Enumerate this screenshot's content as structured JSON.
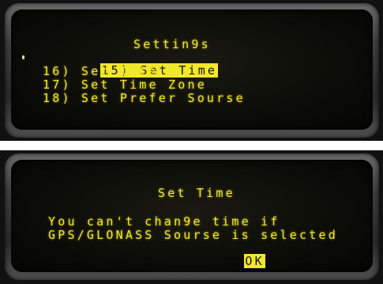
{
  "settings_screen": {
    "title": "Settin9s",
    "items": [
      {
        "label": "15) Set Time",
        "selected": true
      },
      {
        "label": "16) Set Date",
        "selected": false
      },
      {
        "label": "17) Set Time Zone",
        "selected": false
      },
      {
        "label": "18) Set Prefer Sourse",
        "selected": false
      }
    ]
  },
  "set_time_screen": {
    "title": "Set Time",
    "message_line1": "You can't chan9e time if",
    "message_line2": "GPS/GLONASS Sourse is selected",
    "ok_button": "OK"
  },
  "colors": {
    "lcd_text": "#f2e82a",
    "lcd_background": "#0c0c08",
    "highlight_text": "#111111"
  }
}
